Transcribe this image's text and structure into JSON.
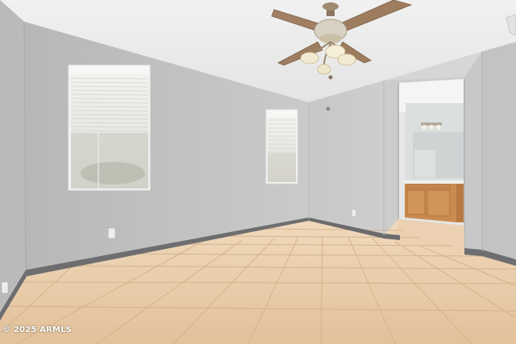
{
  "watermark": {
    "text": "© 2025 ARMLS"
  },
  "colors": {
    "wall_left": "#bdbfbe",
    "wall_back": "#cfd0cf",
    "wall_right": "#c4c5c4",
    "ceiling": "#ecedec",
    "floor_tile": "#e8c9a4",
    "grout": "#d3b08b",
    "baseboard": "#6e6e70",
    "cabinet": "#c98b4f"
  },
  "icons": [
    "ceiling-fan-icon",
    "window-blinds-icon",
    "power-outlet-icon"
  ]
}
